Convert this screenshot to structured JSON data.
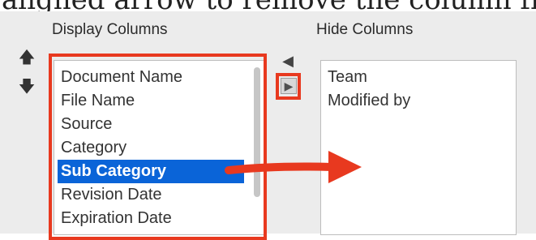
{
  "background_text": "aligned arrow to remove the column from",
  "display_columns": {
    "header": "Display Columns",
    "items": [
      {
        "label": "Document Name"
      },
      {
        "label": "File Name"
      },
      {
        "label": "Source"
      },
      {
        "label": "Category"
      },
      {
        "label": "Sub Category",
        "selected": true
      },
      {
        "label": "Revision Date"
      },
      {
        "label": "Expiration Date"
      }
    ]
  },
  "hide_columns": {
    "header": "Hide Columns",
    "items": [
      {
        "label": "Team"
      },
      {
        "label": "Modified by"
      }
    ]
  },
  "icons": {
    "up": "arrow-up-icon",
    "down": "arrow-down-icon",
    "move_left": "triangle-left-icon",
    "move_right": "triangle-right-icon"
  },
  "colors": {
    "highlight_red": "#e8391f",
    "selection_blue": "#0a64d8",
    "panel_bg": "#ececec"
  }
}
